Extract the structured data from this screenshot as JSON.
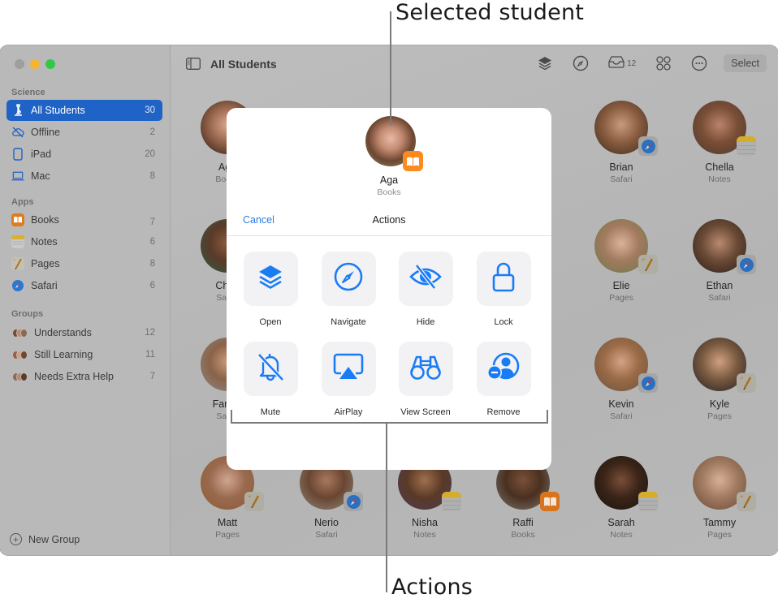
{
  "callouts": {
    "selected_student": "Selected student",
    "actions": "Actions"
  },
  "window": {
    "traffic_lights": [
      "close",
      "minimize",
      "maximize"
    ]
  },
  "sidebar": {
    "sections": [
      {
        "title": "Science",
        "items": [
          {
            "label": "All Students",
            "count": "30",
            "icon": "microscope-icon",
            "active": true
          },
          {
            "label": "Offline",
            "count": "2",
            "icon": "cloud-offline-icon"
          },
          {
            "label": "iPad",
            "count": "20",
            "icon": "ipad-icon"
          },
          {
            "label": "Mac",
            "count": "8",
            "icon": "laptop-icon"
          }
        ]
      },
      {
        "title": "Apps",
        "items": [
          {
            "label": "Books",
            "count": "7",
            "icon": "books-app-icon"
          },
          {
            "label": "Notes",
            "count": "6",
            "icon": "notes-app-icon"
          },
          {
            "label": "Pages",
            "count": "8",
            "icon": "pages-app-icon"
          },
          {
            "label": "Safari",
            "count": "6",
            "icon": "safari-app-icon"
          }
        ]
      },
      {
        "title": "Groups",
        "items": [
          {
            "label": "Understands",
            "count": "12",
            "icon": "group-avatars-icon"
          },
          {
            "label": "Still Learning",
            "count": "11",
            "icon": "group-avatars-icon"
          },
          {
            "label": "Needs Extra Help",
            "count": "7",
            "icon": "group-avatars-icon"
          }
        ]
      }
    ],
    "new_group_label": "New Group"
  },
  "toolbar": {
    "title": "All Students",
    "inbox_count": "12",
    "select_label": "Select",
    "icons": [
      "sidebar-toggle-icon",
      "layers-icon",
      "compass-icon",
      "inbox-icon",
      "grid-icon",
      "more-icon"
    ]
  },
  "students": [
    {
      "name": "Aga",
      "app": "Books"
    },
    {
      "name": "Brian",
      "app": "Safari"
    },
    {
      "name": "Chella",
      "app": "Notes"
    },
    {
      "name": "Chris",
      "app": "Safari"
    },
    {
      "name": "Elie",
      "app": "Pages"
    },
    {
      "name": "Ethan",
      "app": "Safari"
    },
    {
      "name": "Farrah",
      "app": "Safari"
    },
    {
      "name": "Kevin",
      "app": "Safari"
    },
    {
      "name": "Kyle",
      "app": "Pages"
    },
    {
      "name": "Matt",
      "app": "Pages"
    },
    {
      "name": "Nerio",
      "app": "Safari"
    },
    {
      "name": "Nisha",
      "app": "Notes"
    },
    {
      "name": "Raffi",
      "app": "Books"
    },
    {
      "name": "Sarah",
      "app": "Notes"
    },
    {
      "name": "Tammy",
      "app": "Pages"
    }
  ],
  "dialog": {
    "student_name": "Aga",
    "student_app": "Books",
    "cancel_label": "Cancel",
    "title": "Actions",
    "actions": [
      {
        "label": "Open",
        "icon": "layers-icon"
      },
      {
        "label": "Navigate",
        "icon": "compass-icon"
      },
      {
        "label": "Hide",
        "icon": "eye-slash-icon"
      },
      {
        "label": "Lock",
        "icon": "lock-icon"
      },
      {
        "label": "Mute",
        "icon": "bell-slash-icon"
      },
      {
        "label": "AirPlay",
        "icon": "airplay-icon"
      },
      {
        "label": "View Screen",
        "icon": "binoculars-icon"
      },
      {
        "label": "Remove",
        "icon": "person-remove-icon"
      }
    ]
  },
  "colors": {
    "accent": "#1f63c6",
    "action_blue": "#1a7cf5",
    "link_blue": "#2a7de1",
    "books_orange": "#fb8b1e"
  }
}
